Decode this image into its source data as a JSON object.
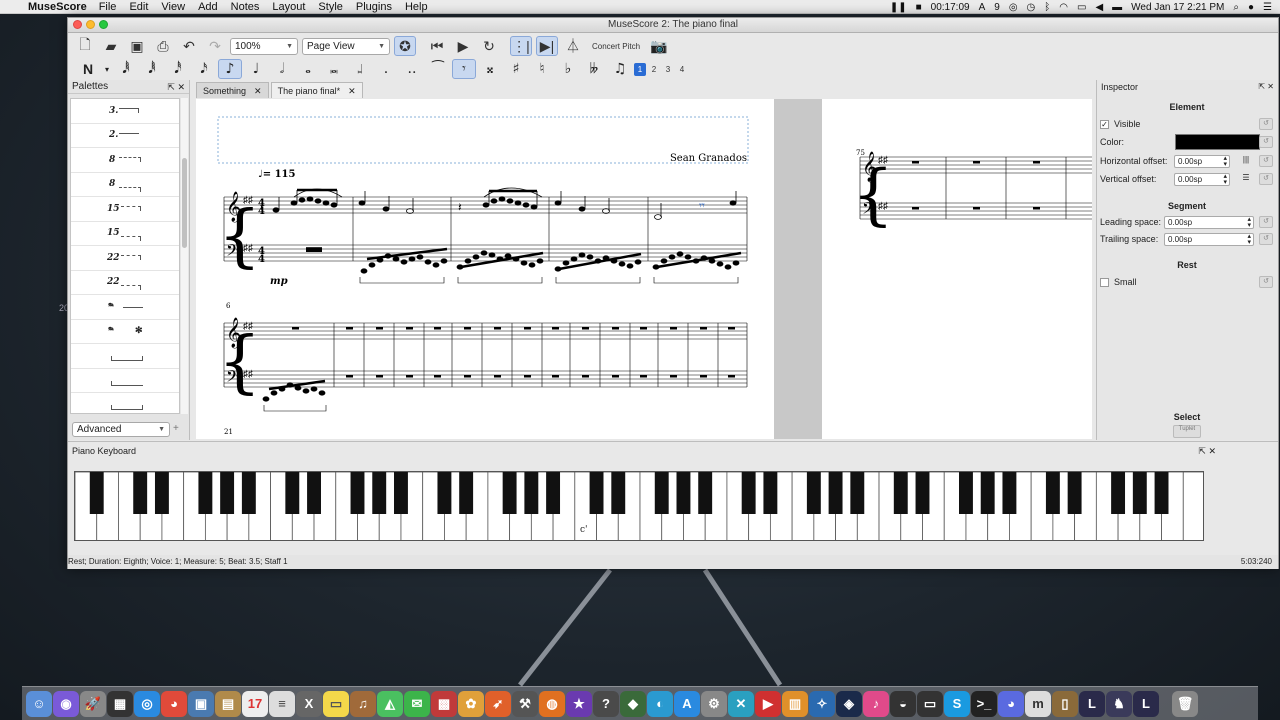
{
  "menubar": {
    "app": "MuseScore",
    "items": [
      "File",
      "Edit",
      "View",
      "Add",
      "Notes",
      "Layout",
      "Style",
      "Plugins",
      "Help"
    ],
    "timer": "00:17:09",
    "badge": "9",
    "datetime": "Wed Jan 17  2:21 PM"
  },
  "window": {
    "title": "MuseScore 2: The piano final"
  },
  "toolbar": {
    "zoom": "100%",
    "view_mode": "Page View",
    "concert_pitch": "Concert Pitch",
    "voices": [
      "1",
      "2",
      "3",
      "4"
    ]
  },
  "palettes": {
    "title": "Palettes",
    "items": [
      "3.",
      "2.",
      "8",
      "8",
      "15",
      "15",
      "22",
      "22",
      "𝆮",
      "𝆮",
      "",
      "",
      ""
    ],
    "mode": "Advanced"
  },
  "tabs": [
    {
      "label": "Something"
    },
    {
      "label": "The piano final*"
    }
  ],
  "score": {
    "composer": "Sean Granados",
    "tempo": "♩= 115",
    "dynamic": "mp",
    "system2_number": "6",
    "system3_number": "21",
    "page2_measure_number": "75"
  },
  "inspector": {
    "title": "Inspector",
    "element_header": "Element",
    "visible_label": "Visible",
    "color_label": "Color:",
    "color_value": "#000000",
    "h_offset_label": "Horizontal offset:",
    "h_offset_value": "0.00sp",
    "v_offset_label": "Vertical offset:",
    "v_offset_value": "0.00sp",
    "segment_header": "Segment",
    "leading_label": "Leading space:",
    "leading_value": "0.00sp",
    "trailing_label": "Trailing space:",
    "trailing_value": "0.00sp",
    "rest_header": "Rest",
    "small_label": "Small",
    "select_header": "Select",
    "tuplet_button": "Tuplet"
  },
  "piano": {
    "title": "Piano Keyboard",
    "marker": "c'"
  },
  "status": {
    "text": "Rest; Duration: Eighth; Voice: 1;  Measure: 5; Beat: 3.5; Staff 1",
    "time": "5:03:240"
  },
  "stray_label": "20"
}
